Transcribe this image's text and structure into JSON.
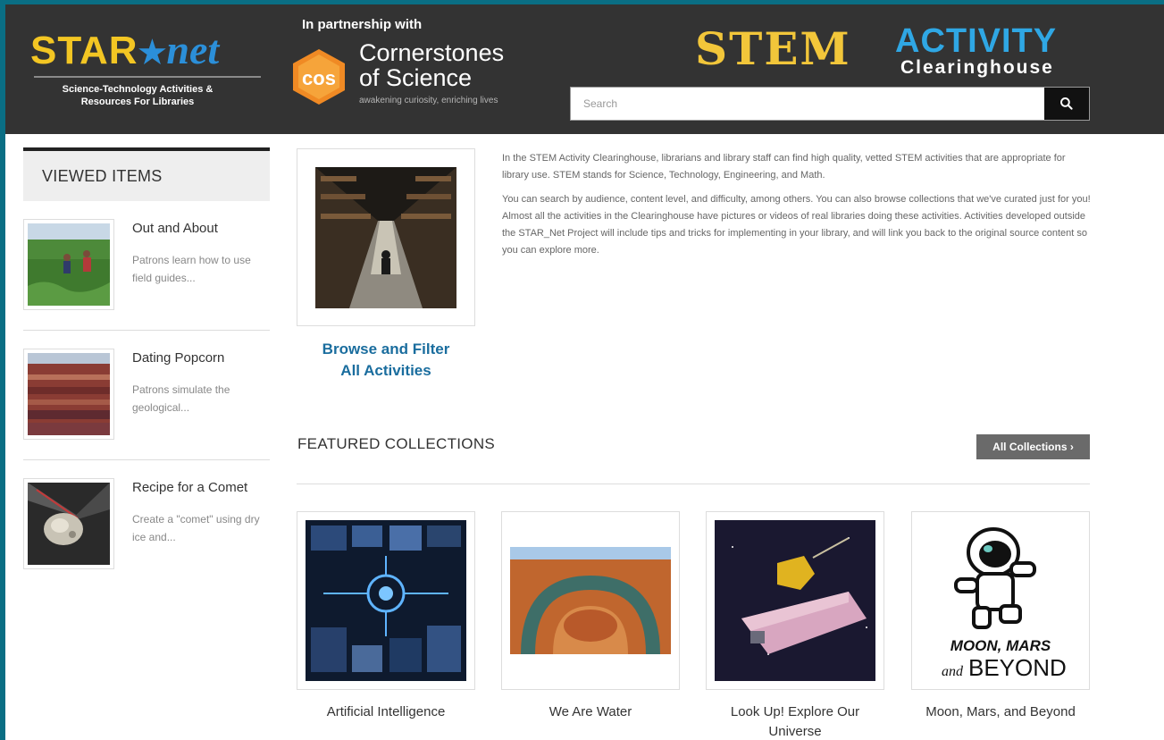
{
  "header": {
    "starnet": {
      "logo_star": "STAR",
      "logo_net": "net",
      "tagline_line1": "Science-Technology Activities &",
      "tagline_line2": "Resources For Libraries"
    },
    "partner": {
      "label": "In partnership with",
      "name_line1": "Cornerstones",
      "name_line2": "of Science",
      "tagline": "awakening curiosity, enriching lives",
      "badge": "cos"
    },
    "stem": {
      "word": "STEM",
      "activity": "ACTIVITY",
      "clearinghouse": "Clearinghouse"
    },
    "search": {
      "placeholder": "Search",
      "icon": "search-icon"
    }
  },
  "sidebar": {
    "heading": "VIEWED ITEMS",
    "items": [
      {
        "title": "Out and About",
        "desc": "Patrons learn how to use field guides..."
      },
      {
        "title": "Dating Popcorn",
        "desc": "Patrons simulate the geological..."
      },
      {
        "title": "Recipe for a Comet",
        "desc": "Create a \"comet\" using dry ice and..."
      }
    ]
  },
  "main": {
    "browse": {
      "line1": "Browse and Filter",
      "line2": "All Activities"
    },
    "intro": {
      "p1": "In the STEM Activity Clearinghouse, librarians and library staff can find high quality, vetted STEM activities that are appropriate for library use. STEM stands for Science, Technology, Engineering, and Math.",
      "p2": "You can search by audience, content level, and difficulty, among others. You can also browse collections that we've curated just for you! Almost all the activities in the Clearinghouse have pictures or videos of real libraries doing these activities. Activities developed outside the STAR_Net Project will include tips and tricks for implementing in your library, and will link you back to the original source content so you can explore more."
    },
    "featured": {
      "title": "FEATURED COLLECTIONS",
      "all_button": "All Collections",
      "cards": [
        {
          "label": "Artificial Intelligence"
        },
        {
          "label": "We Are Water"
        },
        {
          "label": "Look Up! Explore Our Universe"
        },
        {
          "label": "Moon, Mars, and Beyond",
          "image_text_line1": "MOON, MARS",
          "image_text_and": "and",
          "image_text_line2": "BEYOND"
        }
      ]
    }
  },
  "colors": {
    "frame": "#0a6e84",
    "header": "#333333",
    "link": "#1a6d9e",
    "star_yellow": "#f3c623",
    "star_blue": "#2b8fd9",
    "stem_yellow": "#f2c63a",
    "activity_blue": "#2fa7e4",
    "cos_orange": "#f08a24"
  }
}
